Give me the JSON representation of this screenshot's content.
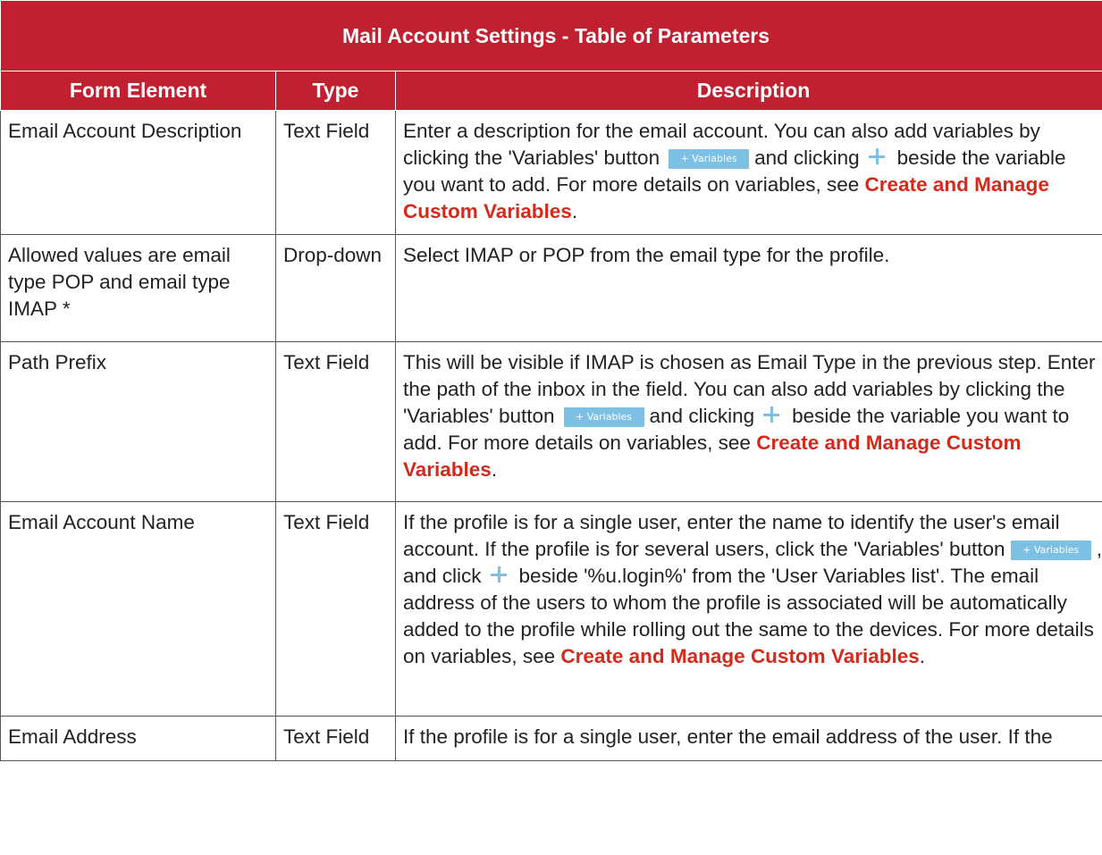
{
  "table": {
    "title": "Mail Account Settings - Table of Parameters",
    "headers": [
      "Form Element",
      "Type",
      "Description"
    ],
    "variables_button_label": "+ Variables",
    "rows": [
      {
        "element": "Email Account Description",
        "type": "Text Field",
        "desc": {
          "a": "Enter a description for the email account. You can also add variables by clicking the 'Variables' button",
          "b": "and clicking",
          "c": "beside the variable you want to add. For more details on variables, see",
          "link": "Create and Manage Custom Variables",
          "end": "."
        }
      },
      {
        "element": "Allowed values are email type POP and email type IMAP *",
        "type": "Drop-down",
        "desc": {
          "a": "Select IMAP or POP from the email type for the profile."
        }
      },
      {
        "element": "Path Prefix",
        "type": "Text Field",
        "desc": {
          "a": "This will be visible if IMAP is chosen as Email Type in the previous step. Enter the path of the inbox in the field. You can also add variables by clicking the 'Variables' button",
          "b": "and clicking",
          "c": "beside the variable you want to add. For more details on variables, see",
          "link": "Create and Manage Custom Variables",
          "end": "."
        }
      },
      {
        "element": "Email Account Name",
        "type": "Text Field",
        "desc": {
          "a": "If the profile is for a single user, enter the name to identify the user's email account. If the profile is for several users, click the 'Variables' button",
          "b": ", and click",
          "c": "beside '%u.login%' from the 'User Variables list'. The email address of the users to whom the profile is associated will be automatically added to the profile while rolling out the same to the devices. For more details on variables, see",
          "link": "Create and Manage Custom Variables",
          "end": "."
        }
      },
      {
        "element": "Email Address",
        "type": "Text Field",
        "desc": {
          "a": "If the profile is for a single user, enter the email address of the user. If the"
        }
      }
    ]
  },
  "colors": {
    "header_bg": "#c0202f",
    "link": "#d42a1c",
    "variables_button": "#7cc0e4"
  }
}
